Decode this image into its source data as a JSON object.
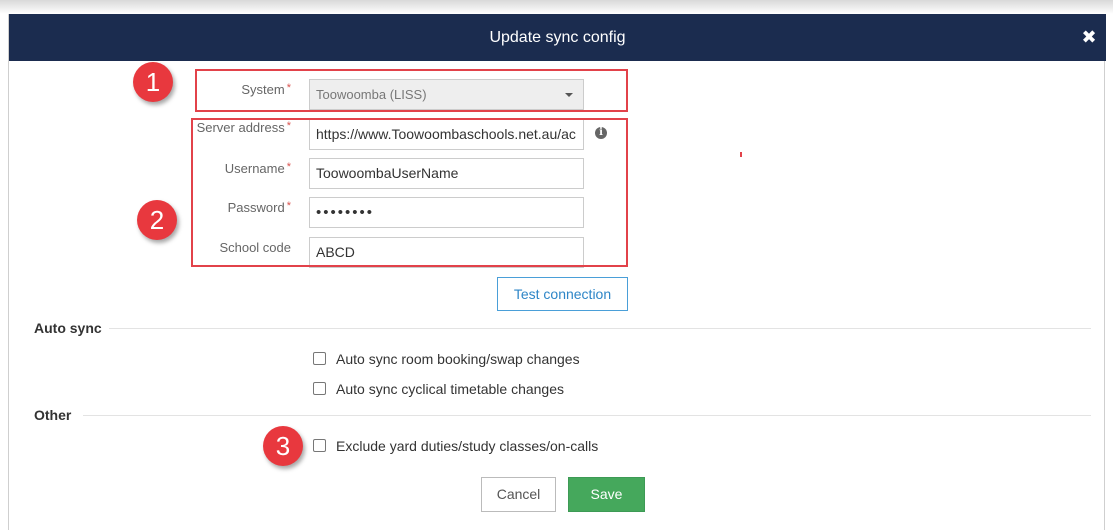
{
  "dialog": {
    "title": "Update sync config",
    "close_icon": "close-icon"
  },
  "form": {
    "system": {
      "label": "System",
      "required_mark": "*",
      "value": "Toowoomba (LISS)"
    },
    "server_address": {
      "label": "Server address",
      "required_mark": "*",
      "value": "https://www.Toowoombaschools.net.au/ac",
      "info_icon": "info-icon"
    },
    "username": {
      "label": "Username",
      "required_mark": "*",
      "value": "ToowoombaUserName"
    },
    "password": {
      "label": "Password",
      "required_mark": "*",
      "value": "••••••••"
    },
    "school_code": {
      "label": "School code",
      "value": "ABCD"
    },
    "test_connection_label": "Test connection"
  },
  "auto_sync": {
    "title": "Auto sync",
    "options": [
      {
        "label": "Auto sync room booking/swap changes",
        "checked": false
      },
      {
        "label": "Auto sync cyclical timetable changes",
        "checked": false
      }
    ]
  },
  "other": {
    "title": "Other",
    "options": [
      {
        "label": "Exclude yard duties/study classes/on-calls",
        "checked": false
      }
    ]
  },
  "footer": {
    "cancel_label": "Cancel",
    "save_label": "Save"
  },
  "annotations": {
    "badge_1": "1",
    "badge_2": "2",
    "badge_3": "3",
    "accent_color": "#e8383e"
  },
  "colors": {
    "header": "#1b2c4f",
    "save_button": "#45a85c",
    "link_blue": "#2e86c7"
  }
}
